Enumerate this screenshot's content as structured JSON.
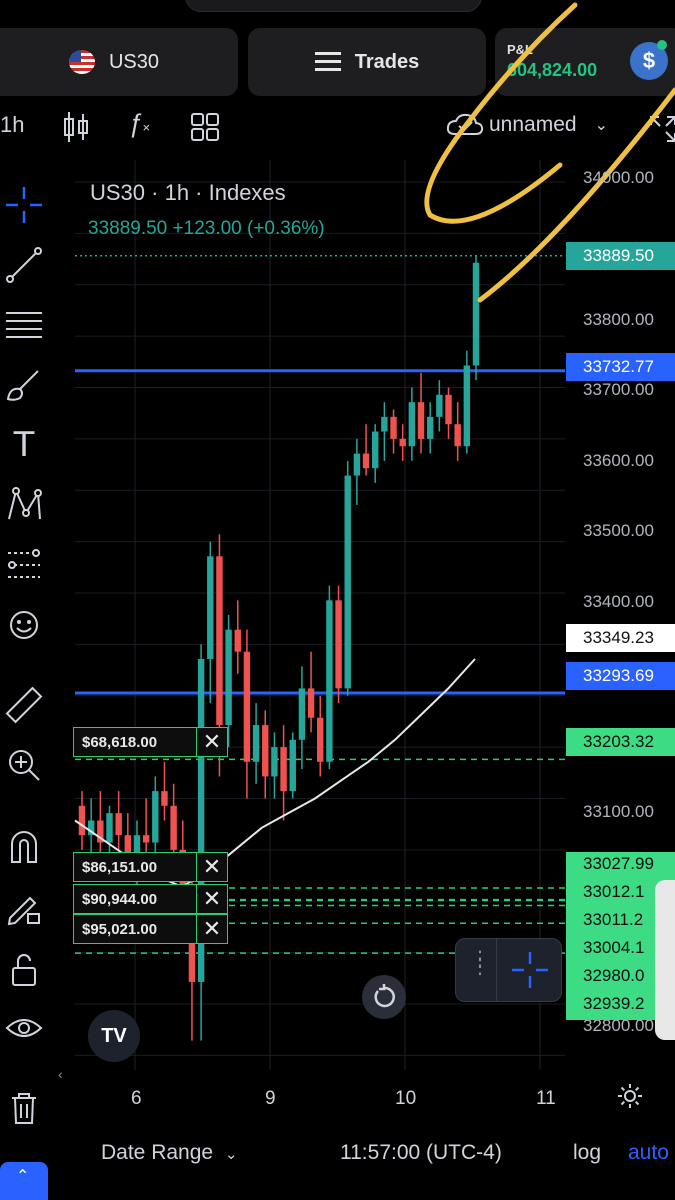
{
  "header": {
    "symbol_label": "US30",
    "trades_label": "Trades",
    "pnl_label": "P&L",
    "pnl_value": "604,824.00",
    "dollar_symbol": "$"
  },
  "toolbar": {
    "interval": "1h",
    "layout_name": "unnamed"
  },
  "legend": {
    "title": "US30 · 1h · Indexes",
    "price_line": "33889.50 +123.00 (+0.36%)"
  },
  "price_axis": {
    "ticks": [
      "34000.00",
      "33800.00",
      "33700.00",
      "33600.00",
      "33500.00",
      "33400.00",
      "33100.00",
      "32800.00"
    ],
    "badges": {
      "last_price": "33889.50",
      "upper_line": "33732.77",
      "crosshair": "33349.23",
      "lower_line": "33293.69",
      "order_1": "33203.32",
      "order_group": [
        "33027.99",
        "33012.1",
        "33011.2",
        "33004.1",
        "32980.0",
        "32939.2"
      ]
    }
  },
  "orders": [
    {
      "amount": "$68,618.00"
    },
    {
      "amount": "$86,151.00"
    },
    {
      "amount": "$90,944.00"
    },
    {
      "amount": "$95,021.00"
    }
  ],
  "time_axis": [
    "6",
    "9",
    "10",
    "11"
  ],
  "bottom": {
    "date_range": "Date Range",
    "clock": "11:57:00 (UTC-4)",
    "log": "log",
    "auto": "auto"
  },
  "logo_text": "TV",
  "colors": {
    "up": "#26a69a",
    "down": "#ef5350",
    "level_line": "#2962ff",
    "order_line": "#2ecc71",
    "annotation": "#f0c040"
  },
  "chart_data": {
    "type": "candlestick",
    "title": "US30 · 1h · Indexes",
    "x_ticks": [
      "6",
      "9",
      "10",
      "11"
    ],
    "ylim": [
      32780,
      34020
    ],
    "levels": [
      33732.77,
      33293.69
    ],
    "order_levels": [
      33203.32,
      33027.99,
      33012.1,
      33011.2,
      33004.1,
      32980.0,
      32939.2
    ],
    "last_price": 33889.5,
    "candles": [
      [
        33140,
        33160,
        33080,
        33100
      ],
      [
        33100,
        33150,
        33050,
        33120
      ],
      [
        33120,
        33160,
        33070,
        33090
      ],
      [
        33090,
        33140,
        33060,
        33130
      ],
      [
        33130,
        33160,
        33080,
        33100
      ],
      [
        33100,
        33130,
        33040,
        33060
      ],
      [
        33060,
        33120,
        33030,
        33100
      ],
      [
        33100,
        33150,
        33070,
        33090
      ],
      [
        33090,
        33180,
        33070,
        33160
      ],
      [
        33160,
        33200,
        33120,
        33140
      ],
      [
        33140,
        33170,
        33060,
        33080
      ],
      [
        33080,
        33120,
        32990,
        33010
      ],
      [
        33010,
        33060,
        32820,
        32900
      ],
      [
        32900,
        33360,
        32820,
        33340
      ],
      [
        33340,
        33500,
        33280,
        33480
      ],
      [
        33480,
        33510,
        33180,
        33250
      ],
      [
        33250,
        33400,
        33220,
        33380
      ],
      [
        33380,
        33420,
        33320,
        33350
      ],
      [
        33350,
        33380,
        33150,
        33200
      ],
      [
        33200,
        33280,
        33170,
        33250
      ],
      [
        33250,
        33270,
        33150,
        33180
      ],
      [
        33180,
        33240,
        33150,
        33220
      ],
      [
        33220,
        33250,
        33120,
        33160
      ],
      [
        33160,
        33240,
        33150,
        33230
      ],
      [
        33230,
        33330,
        33190,
        33300
      ],
      [
        33300,
        33350,
        33240,
        33260
      ],
      [
        33260,
        33290,
        33180,
        33200
      ],
      [
        33200,
        33440,
        33190,
        33420
      ],
      [
        33420,
        33440,
        33280,
        33300
      ],
      [
        33300,
        33610,
        33290,
        33590
      ],
      [
        33590,
        33640,
        33550,
        33620
      ],
      [
        33620,
        33660,
        33590,
        33600
      ],
      [
        33600,
        33660,
        33580,
        33650
      ],
      [
        33650,
        33690,
        33610,
        33670
      ],
      [
        33670,
        33680,
        33620,
        33640
      ],
      [
        33640,
        33660,
        33610,
        33630
      ],
      [
        33630,
        33710,
        33610,
        33690
      ],
      [
        33690,
        33730,
        33620,
        33640
      ],
      [
        33640,
        33690,
        33620,
        33670
      ],
      [
        33670,
        33720,
        33650,
        33700
      ],
      [
        33700,
        33710,
        33640,
        33660
      ],
      [
        33660,
        33690,
        33610,
        33630
      ],
      [
        33630,
        33760,
        33620,
        33740
      ],
      [
        33740,
        33890,
        33720,
        33880
      ]
    ],
    "moving_average": [
      33120,
      33095,
      33070,
      33045,
      33030,
      33050,
      33080,
      33110,
      33130,
      33150,
      33175,
      33200,
      33230,
      33265,
      33300,
      33340
    ]
  }
}
